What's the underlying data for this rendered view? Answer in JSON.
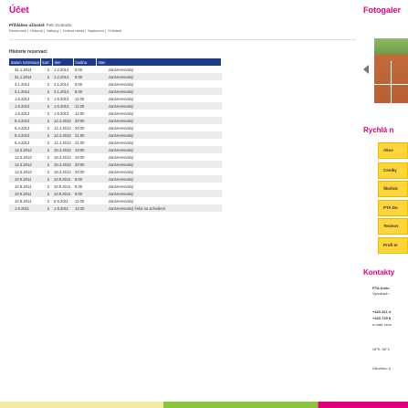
{
  "header": {
    "title": "Účet"
  },
  "login": {
    "label": "Přihlášen uživatel:",
    "user": "Petr Svoboda"
  },
  "menu": {
    "items": [
      "Rezervace",
      "Historie",
      "Nákupy",
      "Změna hesla",
      "Nastavení",
      "Odhlásit"
    ],
    "separator": "|"
  },
  "section": {
    "title": "Historie rezervací"
  },
  "table": {
    "headers": [
      "datum rezervace",
      "kurt",
      "den",
      "hodina",
      "stav"
    ],
    "rows": [
      [
        "31.1.2014",
        "2",
        "1.2.2014",
        "9:00",
        "zarezervováný"
      ],
      [
        "31.1.2014",
        "2",
        "1.2.2014",
        "9:30",
        "zarezervováný"
      ],
      [
        "2.1.2014",
        "2",
        "3.1.2014",
        "8:00",
        "zarezervováný"
      ],
      [
        "2.1.2014",
        "2",
        "3.1.2014",
        "8:30",
        "zarezervováný"
      ],
      [
        "1.6.2013",
        "3",
        "1.6.2013",
        "11:00",
        "zarezervováný"
      ],
      [
        "1.6.2013",
        "3",
        "1.6.2013",
        "11:30",
        "zarezervováný"
      ],
      [
        "1.6.2013",
        "3",
        "1.6.2013",
        "12:00",
        "zarezervováný"
      ],
      [
        "9.4.2013",
        "2",
        "12.4.2013",
        "20:00",
        "zarezervováný"
      ],
      [
        "9.4.2013",
        "2",
        "12.4.2013",
        "20:30",
        "zarezervováný"
      ],
      [
        "9.4.2013",
        "2",
        "12.4.2013",
        "21:00",
        "zarezervováný"
      ],
      [
        "9.4.2013",
        "2",
        "12.4.2013",
        "21:30",
        "zarezervováný"
      ],
      [
        "12.3.2013",
        "2",
        "15.3.2013",
        "19:00",
        "zarezervováný"
      ],
      [
        "12.3.2013",
        "2",
        "15.3.2013",
        "19:30",
        "zarezervováný"
      ],
      [
        "12.3.2013",
        "2",
        "15.3.2013",
        "20:00",
        "zarezervováný"
      ],
      [
        "12.3.2013",
        "2",
        "15.3.2013",
        "20:30",
        "zarezervováný"
      ],
      [
        "10.9.2011",
        "2",
        "10.9.2011",
        "8:00",
        "zarezervováný"
      ],
      [
        "10.9.2011",
        "2",
        "10.9.2011",
        "8:30",
        "zarezervováný"
      ],
      [
        "10.9.2011",
        "2",
        "10.9.2011",
        "9:00",
        "zarezervováný"
      ],
      [
        "10.9.2011",
        "2",
        "5.9.2011",
        "11:00",
        "zarezervováný"
      ],
      [
        "1.9.2011",
        "2",
        "1.9.2011",
        "14:30",
        "zarezervováný-čeká na schválení"
      ]
    ]
  },
  "sidebar": {
    "title": "Fotogaler",
    "quick_title": "Rychlá n",
    "buttons": [
      "Akce",
      "Ceníky",
      "Školick",
      "PTA Do",
      "Tenisov",
      "Profi te"
    ],
    "contacts_title": "Kontakty",
    "contact_lines": [
      "PTA Kolín",
      "Vjezd/ach",
      "+420 321 4",
      "+420 725 8",
      "e-mail: rece",
      "GPS: 50°2",
      "Otevřeno d"
    ]
  },
  "colors": {
    "accent": "#e1007a",
    "header": "#1e3a8a",
    "button": "#ffd53c"
  }
}
